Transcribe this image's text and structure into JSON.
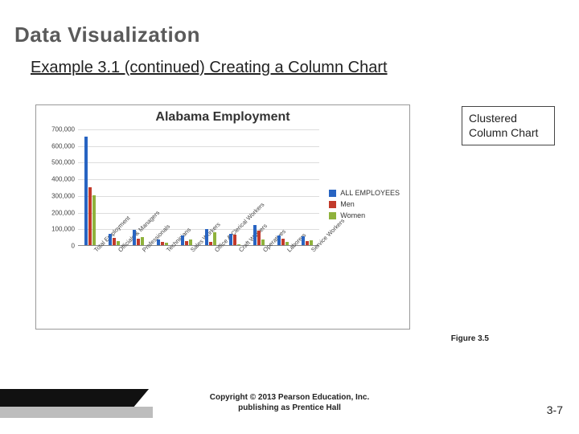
{
  "page_title": "Data Visualization",
  "subtitle": "Example 3.1  (continued)  Creating a Column Chart",
  "callout": "Clustered Column Chart",
  "figure_label": "Figure 3.5",
  "copyright_line1": "Copyright © 2013 Pearson Education, Inc.",
  "copyright_line2": "publishing as Prentice Hall",
  "page_number": "3-7",
  "chart_data": {
    "type": "bar",
    "title": "Alabama Employment",
    "xlabel": "",
    "ylabel": "",
    "ylim": [
      0,
      700000
    ],
    "y_ticks": [
      0,
      100000,
      200000,
      300000,
      400000,
      500000,
      600000,
      700000
    ],
    "y_tick_labels": [
      "0",
      "100,000",
      "200,000",
      "300,000",
      "400,000",
      "500,000",
      "600,000",
      "700,000"
    ],
    "categories": [
      "Total Employment",
      "Officials & Managers",
      "Professionals",
      "Technicians",
      "Sales Workers",
      "Office & Clerical Workers",
      "Craft Workers",
      "Operatives",
      "Laborers",
      "Service Workers"
    ],
    "series": [
      {
        "name": "ALL EMPLOYEES",
        "class": "all",
        "values": [
          650000,
          70000,
          90000,
          35000,
          60000,
          95000,
          70000,
          120000,
          60000,
          55000
        ]
      },
      {
        "name": "Men",
        "class": "men",
        "values": [
          350000,
          45000,
          40000,
          20000,
          25000,
          20000,
          65000,
          85000,
          40000,
          25000
        ]
      },
      {
        "name": "Women",
        "class": "women",
        "values": [
          300000,
          25000,
          50000,
          15000,
          35000,
          75000,
          5000,
          35000,
          20000,
          30000
        ]
      }
    ]
  }
}
